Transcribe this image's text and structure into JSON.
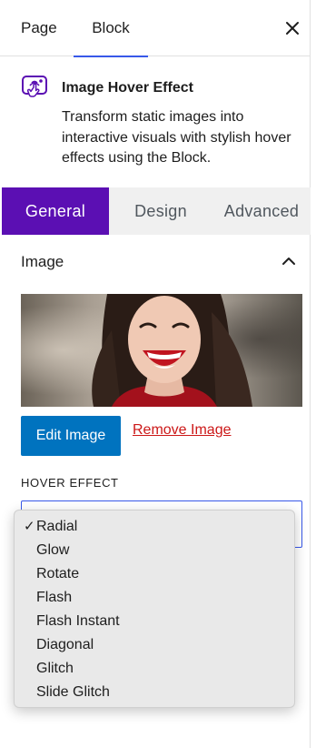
{
  "header": {
    "tabs": [
      {
        "label": "Page"
      },
      {
        "label": "Block"
      }
    ],
    "close_icon": "close-icon"
  },
  "block": {
    "icon": "image-hover-icon",
    "title": "Image Hover Effect",
    "description": "Transform static images into interactive visuals with stylish hover effects using the Block."
  },
  "panel_tabs": [
    {
      "label": "General"
    },
    {
      "label": "Design"
    },
    {
      "label": "Advanced"
    }
  ],
  "image_section": {
    "title": "Image",
    "edit_label": "Edit Image",
    "remove_label": "Remove Image"
  },
  "hover_effect": {
    "label": "HOVER EFFECT",
    "selected": "Radial",
    "options": [
      "Radial",
      "Glow",
      "Rotate",
      "Flash",
      "Flash Instant",
      "Diagonal",
      "Glitch",
      "Slide Glitch"
    ]
  },
  "colors": {
    "accent": "#3858e9",
    "general_tab": "#5b0fb3",
    "edit_button": "#0073bf",
    "remove_link": "#cc1818"
  }
}
